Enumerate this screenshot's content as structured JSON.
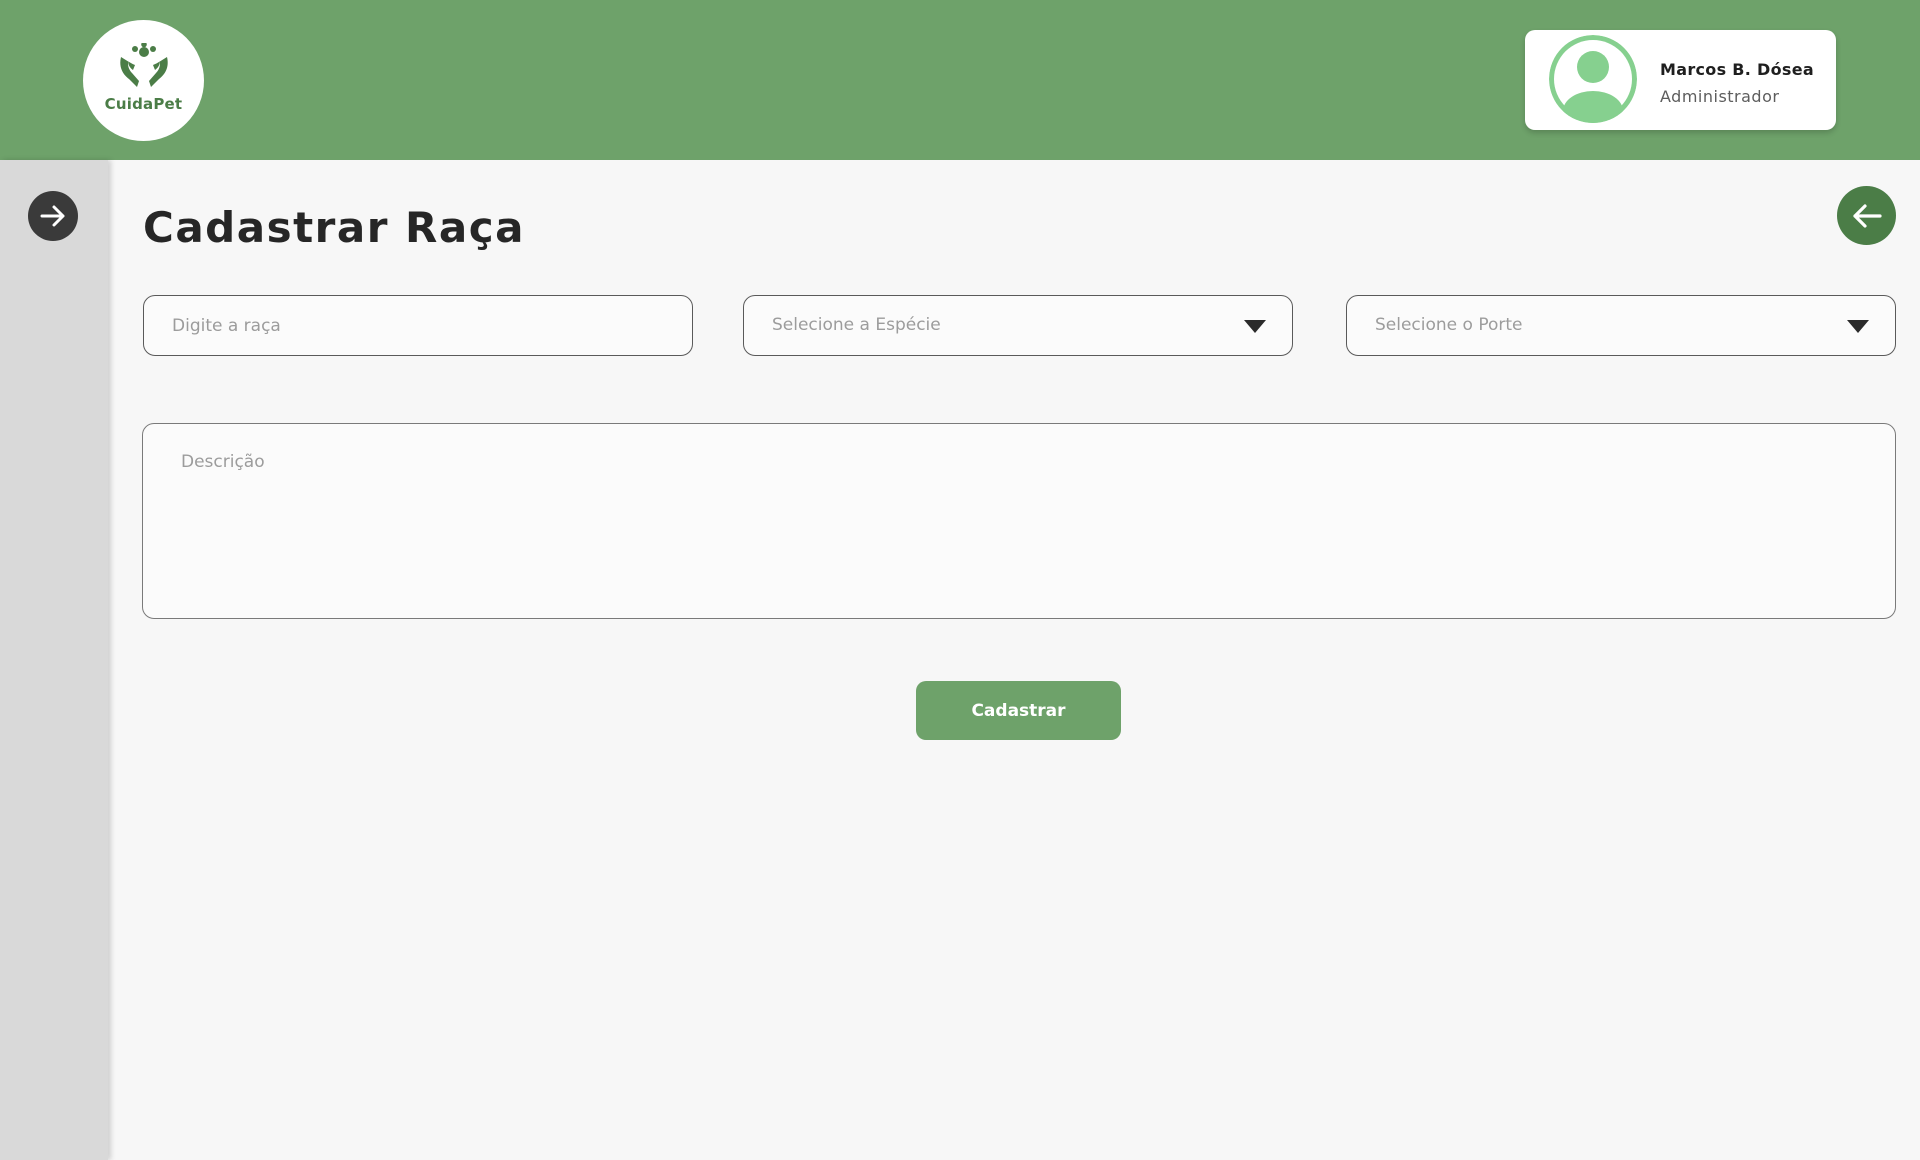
{
  "brand": {
    "name": "CuidaPet",
    "icon": "paw-hands-icon",
    "accent": "#6ea26a",
    "accent_dark": "#4b7d47"
  },
  "user": {
    "name": "Marcos B. Dósea",
    "role": "Administrador",
    "avatar_icon": "user-avatar-icon",
    "avatar_color": "#86d08f"
  },
  "sidebar": {
    "toggle_icon": "arrow-right-icon"
  },
  "page": {
    "title": "Cadastrar Raça",
    "back_icon": "arrow-left-icon"
  },
  "form": {
    "breed_placeholder": "Digite a raça",
    "species_placeholder": "Selecione a Espécie",
    "size_placeholder": "Selecione o Porte",
    "description_placeholder": "Descrição",
    "submit_label": "Cadastrar"
  }
}
